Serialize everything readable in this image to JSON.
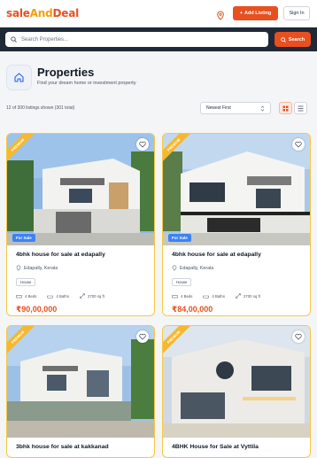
{
  "header": {
    "logo_part1": "sale",
    "logo_part2": "And",
    "logo_part3": "Deal",
    "add_listing": "Add Listing",
    "sign_in": "Sign In"
  },
  "search": {
    "placeholder": "Search Properties...",
    "button": "Search"
  },
  "page": {
    "title": "Properties",
    "subtitle": "Find your dream home or investment property",
    "count_text": "12 of 300 listings shown (301 total)",
    "sort_value": "Newest First"
  },
  "listings": [
    {
      "badge": "PREMIUM",
      "status": "For Sale",
      "title": "4bhk house for sale at edapally",
      "location": "Edapally, Kerala",
      "type": "House",
      "beds": "4 Beds",
      "baths": "4 Baths",
      "area": "2700 sq ft",
      "price": "₹90,00,000"
    },
    {
      "badge": "PREMIUM",
      "status": "For Sale",
      "title": "4bhk house for sale at edapally",
      "location": "Edapally, Kerala",
      "type": "House",
      "beds": "4 Beds",
      "baths": "4 Baths",
      "area": "2700 sq ft",
      "price": "₹84,00,000"
    },
    {
      "badge": "PREMIUM",
      "title": "3bhk house for sale at kakkanad"
    },
    {
      "badge": "PREMIUM",
      "title": "4BHK House for Sale at Vyttila"
    }
  ],
  "colors": {
    "accent": "#e8501f",
    "premium": "#f5b82e",
    "for_sale": "#3b82f6"
  }
}
